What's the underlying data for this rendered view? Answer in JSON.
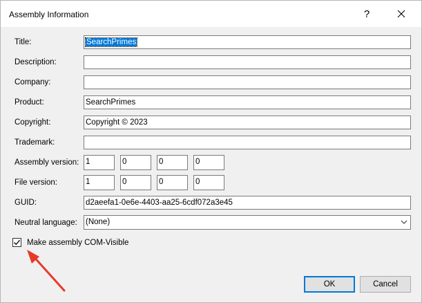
{
  "window": {
    "title": "Assembly Information",
    "help_glyph": "?",
    "close_icon": "close-icon"
  },
  "fields": {
    "title": {
      "label": "Title:",
      "value": "SearchPrimes"
    },
    "description": {
      "label": "Description:",
      "value": ""
    },
    "company": {
      "label": "Company:",
      "value": ""
    },
    "product": {
      "label": "Product:",
      "value": "SearchPrimes"
    },
    "copyright": {
      "label": "Copyright:",
      "value": "Copyright ©  2023"
    },
    "trademark": {
      "label": "Trademark:",
      "value": ""
    },
    "assembly_version": {
      "label": "Assembly version:",
      "parts": [
        "1",
        "0",
        "0",
        "0"
      ]
    },
    "file_version": {
      "label": "File version:",
      "parts": [
        "1",
        "0",
        "0",
        "0"
      ]
    },
    "guid": {
      "label": "GUID:",
      "value": "d2aeefa1-0e6e-4403-aa25-6cdf072a3e45"
    },
    "neutral_language": {
      "label": "Neutral language:",
      "value": "(None)"
    }
  },
  "com_visible": {
    "label": "Make assembly COM-Visible",
    "checked": true
  },
  "buttons": {
    "ok": "OK",
    "cancel": "Cancel"
  },
  "colors": {
    "selection": "#0078d7",
    "annotation_arrow": "#e8392a"
  }
}
